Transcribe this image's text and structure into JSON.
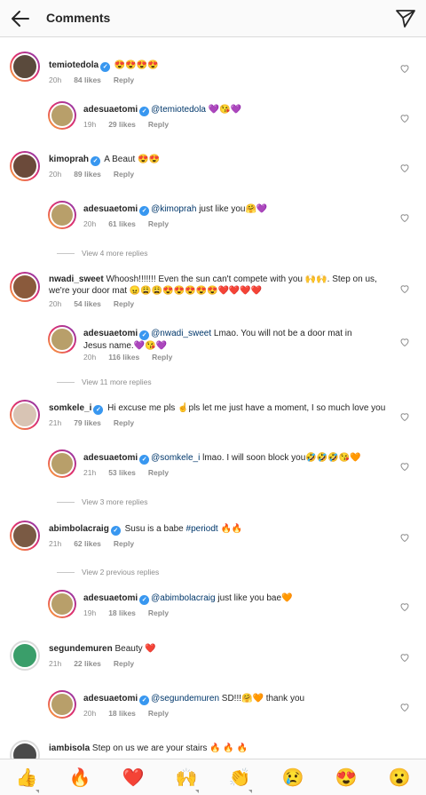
{
  "header": {
    "title": "Comments"
  },
  "labels": {
    "reply": "Reply"
  },
  "comments": [
    {
      "user": "temiotedola",
      "text": " 😍😍😍😍",
      "time": "20h",
      "likes": "84 likes",
      "reply": false
    },
    {
      "user": "adesuaetomi",
      "mention": "@temiotedola",
      "text": " 💜😘💜",
      "time": "19h",
      "likes": "29 likes",
      "reply": true
    },
    {
      "user": "kimoprah",
      "text": " A Beaut 😍😍",
      "time": "20h",
      "likes": "89 likes",
      "reply": false
    },
    {
      "user": "adesuaetomi",
      "mention": "@kimoprah",
      "text": " just like you🤗💜",
      "time": "20h",
      "likes": "61 likes",
      "reply": true
    },
    {
      "more": "View 4 more replies"
    },
    {
      "user": "nwadi_sweet",
      "text": " Whoosh!!!!!!! Even the sun can't compete with you 🙌🙌. Step on us, we're your door mat 😠😩😩😍😍😍😍😍❤️❤️❤️❤️",
      "time": "20h",
      "likes": "54 likes",
      "reply": false
    },
    {
      "user": "adesuaetomi",
      "mention": "@nwadi_sweet",
      "text": " Lmao. You will not be a door mat in Jesus name.💜😘💜",
      "time": "20h",
      "likes": "116 likes",
      "reply": true
    },
    {
      "more": "View 11 more replies"
    },
    {
      "user": "somkele_i",
      "text": " Hi excuse me pls ☝️pls let me just have a moment, I so much love you",
      "time": "21h",
      "likes": "79 likes",
      "reply": false
    },
    {
      "user": "adesuaetomi",
      "mention": "@somkele_i",
      "text": " lmao. I will soon block you🤣🤣🤣😘🧡",
      "time": "21h",
      "likes": "53 likes",
      "reply": true
    },
    {
      "more": "View 3 more replies"
    },
    {
      "user": "abimbolacraig",
      "text": " Susu is a babe ",
      "hashtag": "#periodt",
      "text2": " 🔥🔥",
      "time": "21h",
      "likes": "62 likes",
      "reply": false
    },
    {
      "more": "View 2 previous replies"
    },
    {
      "user": "adesuaetomi",
      "mention": "@abimbolacraig",
      "text": " just like you bae🧡",
      "time": "19h",
      "likes": "18 likes",
      "reply": true
    },
    {
      "user": "segundemuren",
      "text": " Beauty ❤️",
      "time": "21h",
      "likes": "22 likes",
      "reply": false
    },
    {
      "user": "adesuaetomi",
      "mention": "@segundemuren",
      "text": " SD!!!🤗🧡 thank you",
      "time": "20h",
      "likes": "18 likes",
      "reply": true
    },
    {
      "user": "iambisola",
      "text": " Step on us we are your stairs 🔥 🔥 🔥",
      "time": "",
      "likes": "",
      "reply": false
    }
  ],
  "emojis": [
    "👍",
    "🔥",
    "❤️",
    "🙌",
    "👏",
    "😢",
    "😍",
    "😮"
  ],
  "colors": {
    "link": "#00376b",
    "verified": "#3897f0",
    "meta": "#8e8e8e"
  }
}
